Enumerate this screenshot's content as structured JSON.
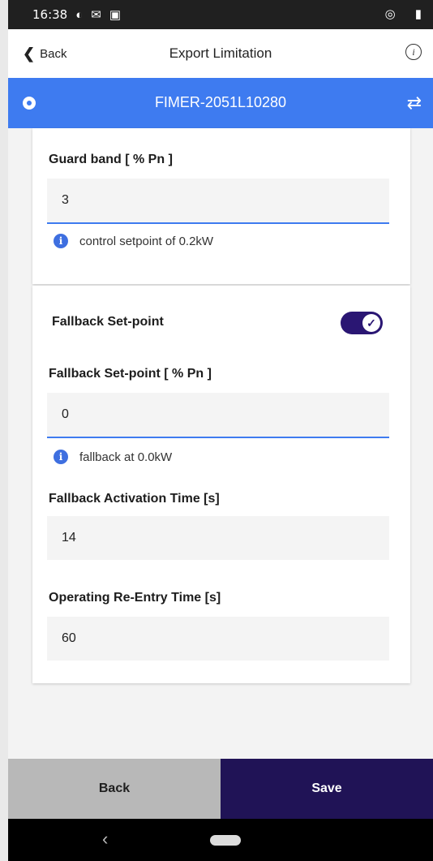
{
  "status_bar": {
    "time": "16:38",
    "icons_left": [
      "cloud-sync-icon",
      "mail-icon",
      "download-icon"
    ],
    "icons_right": [
      "vibrate-icon",
      "battery-icon"
    ]
  },
  "header": {
    "back_label": "Back",
    "title": "Export Limitation",
    "info_icon": "info-icon"
  },
  "device_bar": {
    "name": "FIMER-2051L10280",
    "color": "#3e7bf0"
  },
  "guard_band": {
    "label": "Guard band [ % Pn ]",
    "value": "3",
    "hint": "control setpoint of 0.2kW"
  },
  "fallback": {
    "toggle_label": "Fallback Set-point",
    "toggle_on": true,
    "setpoint_label": "Fallback Set-point [ % Pn ]",
    "setpoint_value": "0",
    "setpoint_hint": "fallback at 0.0kW",
    "activation_label": "Fallback Activation Time [s]",
    "activation_value": "14",
    "reentry_label": "Operating Re-Entry Time [s]",
    "reentry_value": "60"
  },
  "footer": {
    "back_label": "Back",
    "save_label": "Save",
    "save_color": "#201356"
  }
}
